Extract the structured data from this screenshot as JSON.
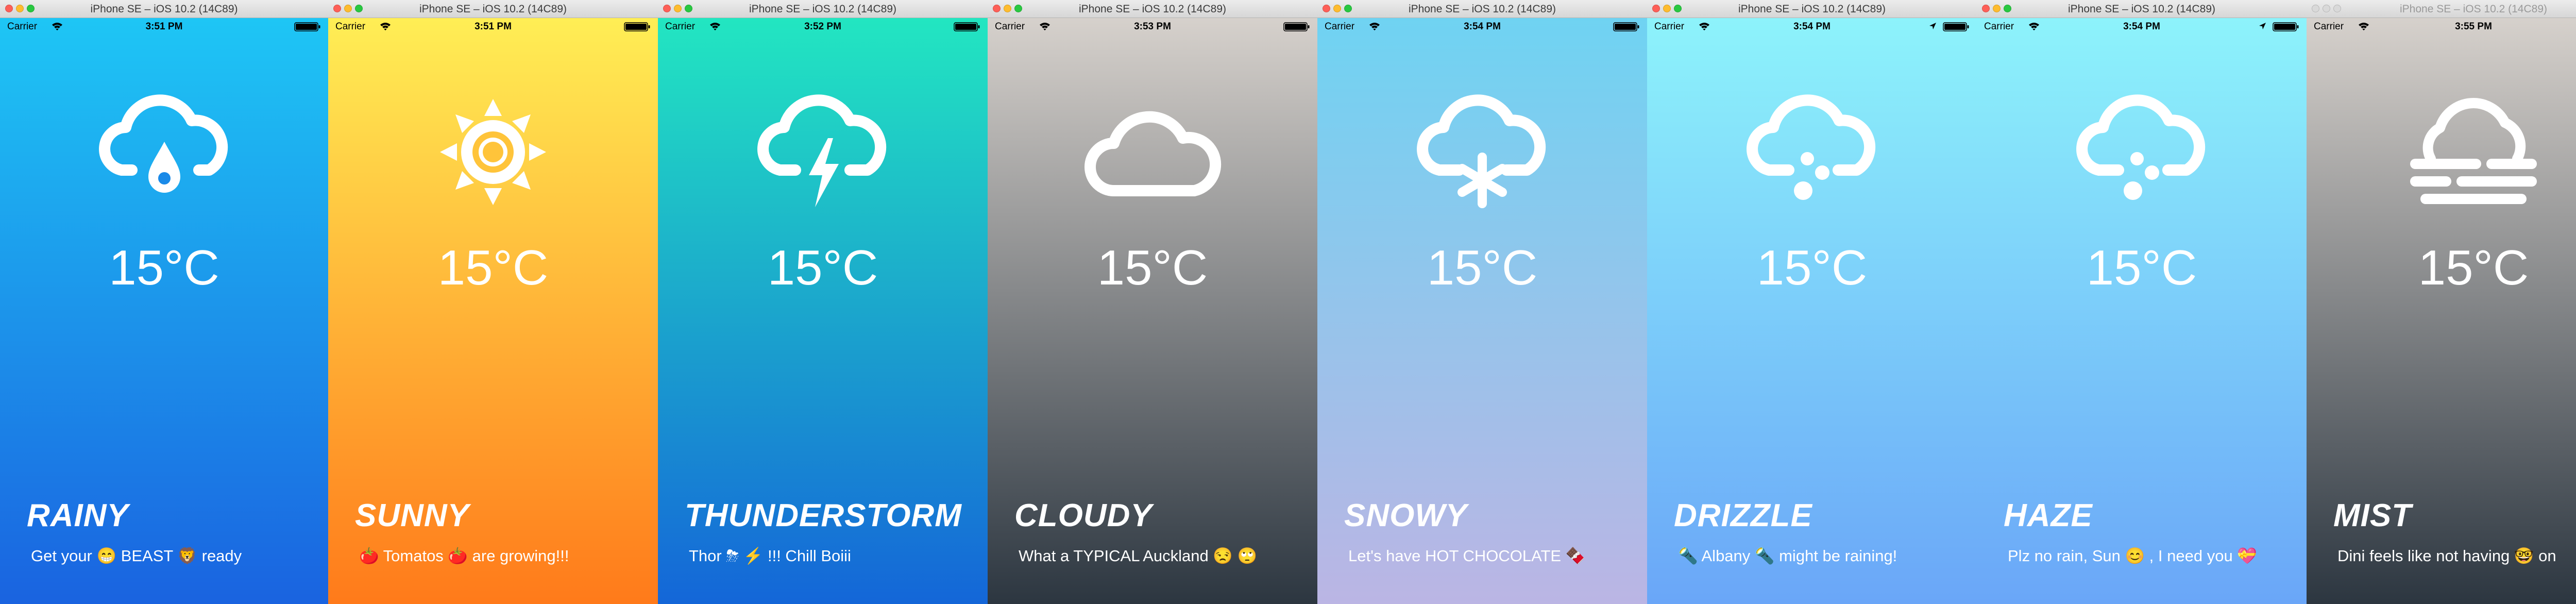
{
  "window_title": "iPhone SE – iOS 10.2 (14C89)",
  "carrier": "Carrier",
  "temperature": "15°C",
  "screens": [
    {
      "time": "3:51 PM",
      "condition": "RAINY",
      "message": "Get your 😁 BEAST 🦁 ready",
      "icon": "rain-cloud-icon",
      "gradient": [
        "#1ec6f5",
        "#1a63e0"
      ],
      "status_color": "#000000",
      "location_arrow": false
    },
    {
      "time": "3:51 PM",
      "condition": "SUNNY",
      "message": "🍅 Tomatos 🍅 are growing!!!",
      "icon": "sun-icon",
      "gradient": [
        "#ffee55",
        "#ff7a1a"
      ],
      "status_color": "#000000",
      "location_arrow": false
    },
    {
      "time": "3:52 PM",
      "condition": "THUNDERSTORM",
      "message": "Thor ⛈ ⚡ !!! Chill Boiii",
      "icon": "thunderstorm-cloud-icon",
      "gradient": [
        "#22e6c1",
        "#1466d8"
      ],
      "status_color": "#000000",
      "location_arrow": false
    },
    {
      "time": "3:53 PM",
      "condition": "CLOUDY",
      "message": "What a TYPICAL Auckland 😒 🙄",
      "icon": "cloud-icon",
      "gradient": [
        "#d6d1cc",
        "#2c3640"
      ],
      "status_color": "#000000",
      "location_arrow": false
    },
    {
      "time": "3:54 PM",
      "condition": "SNOWY",
      "message": "Let's have HOT CHOCOLATE 🍫",
      "icon": "snow-cloud-icon",
      "gradient": [
        "#6fd3f2",
        "#bbb5e4"
      ],
      "status_color": "#000000",
      "location_arrow": false
    },
    {
      "time": "3:54 PM",
      "condition": "DRIZZLE",
      "message": "🔦 Albany 🔦 might be raining!",
      "icon": "drizzle-cloud-icon",
      "gradient": [
        "#8df3fb",
        "#6aa6f8"
      ],
      "status_color": "#000000",
      "location_arrow": true
    },
    {
      "time": "3:54 PM",
      "condition": "HAZE",
      "message": "Plz no rain, Sun 😊 , I need you 💝",
      "icon": "haze-cloud-icon",
      "gradient": [
        "#8df3fb",
        "#6aa6f8"
      ],
      "status_color": "#000000",
      "location_arrow": true
    },
    {
      "time": "3:55 PM",
      "condition": "MIST",
      "message": "Dini feels like not having 🤓 on",
      "icon": "mist-cloud-icon",
      "gradient": [
        "#d6d1cc",
        "#2c3640"
      ],
      "status_color": "#000000",
      "location_arrow": false
    }
  ]
}
